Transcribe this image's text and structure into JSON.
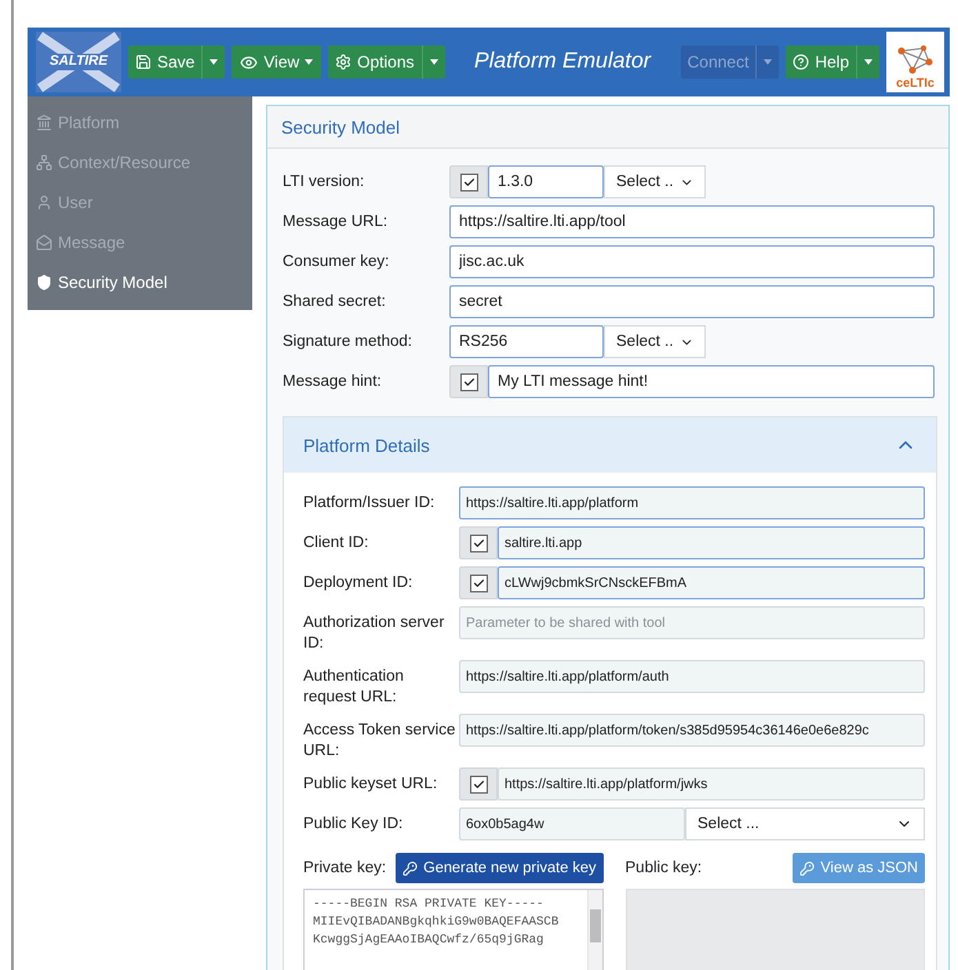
{
  "header": {
    "logo": "SALTIRE",
    "title": "Platform Emulator",
    "badge": "ceLTIc",
    "left_buttons": [
      {
        "label": "Save",
        "kind": "save",
        "split": true,
        "disabled": false
      },
      {
        "label": "View",
        "kind": "view",
        "split": false,
        "disabled": false
      },
      {
        "label": "Options",
        "kind": "options",
        "split": true,
        "disabled": false
      }
    ],
    "right_buttons": [
      {
        "label": "Connect",
        "kind": "connect",
        "split": true,
        "disabled": true
      },
      {
        "label": "Help",
        "kind": "help",
        "split": true,
        "disabled": false
      }
    ]
  },
  "sidebar": {
    "items": [
      {
        "label": "Platform",
        "kind": "platform",
        "selected": false
      },
      {
        "label": "Context/Resource",
        "kind": "context",
        "selected": false
      },
      {
        "label": "User",
        "kind": "user",
        "selected": false
      },
      {
        "label": "Message",
        "kind": "message",
        "selected": false
      },
      {
        "label": "Security Model",
        "kind": "security",
        "selected": true
      }
    ]
  },
  "security": {
    "title": "Security Model",
    "fields": [
      {
        "label": "LTI version:",
        "kind": "check-select",
        "checked": true,
        "value": "1.3.0",
        "select": "Select .."
      },
      {
        "label": "Message URL:",
        "kind": "text",
        "value": "https://saltire.lti.app/tool"
      },
      {
        "label": "Consumer key:",
        "kind": "text",
        "value": "jisc.ac.uk"
      },
      {
        "label": "Shared secret:",
        "kind": "text",
        "value": "secret"
      },
      {
        "label": "Signature method:",
        "kind": "select",
        "value": "RS256",
        "select": "Select .."
      },
      {
        "label": "Message hint:",
        "kind": "check",
        "checked": true,
        "value": "My LTI message hint!"
      }
    ]
  },
  "platform_details": {
    "title": "Platform Details",
    "expanded": true,
    "fields": [
      {
        "label": "Platform/Issuer ID:",
        "kind": "text",
        "outlined": true,
        "value": "https://saltire.lti.app/platform"
      },
      {
        "label": "Client ID:",
        "kind": "check",
        "outlined": true,
        "checked": true,
        "value": "saltire.lti.app"
      },
      {
        "label": "Deployment ID:",
        "kind": "check",
        "outlined": true,
        "checked": true,
        "value": "cLWwj9cbmkSrCNsckEFBmA"
      },
      {
        "label": "Authorization server ID:",
        "kind": "placeholder",
        "outlined": false,
        "placeholder": "Parameter to be shared with tool"
      },
      {
        "label": "Authentication request URL:",
        "kind": "text",
        "outlined": false,
        "value": "https://saltire.lti.app/platform/auth"
      },
      {
        "label": "Access Token service URL:",
        "kind": "text",
        "outlined": false,
        "value": "https://saltire.lti.app/platform/token/s385d95954c36146e0e6e829c"
      },
      {
        "label": "Public keyset URL:",
        "kind": "check",
        "outlined": false,
        "checked": true,
        "value": "https://saltire.lti.app/platform/jwks"
      },
      {
        "label": "Public Key ID:",
        "kind": "select",
        "outlined": false,
        "value": "6ox0b5ag4w",
        "select": "Select ..."
      }
    ],
    "private_key": {
      "label": "Private key:",
      "button": "Generate new private key",
      "lines": [
        "-----BEGIN RSA PRIVATE KEY-----",
        "MIIEvQIBADANBgkqhkiG9w0BAQEFAASCB",
        "KcwggSjAgEAAoIBAQCwfz/65q9jGRag"
      ]
    },
    "public_key": {
      "label": "Public key:",
      "button": "View as JSON"
    }
  }
}
